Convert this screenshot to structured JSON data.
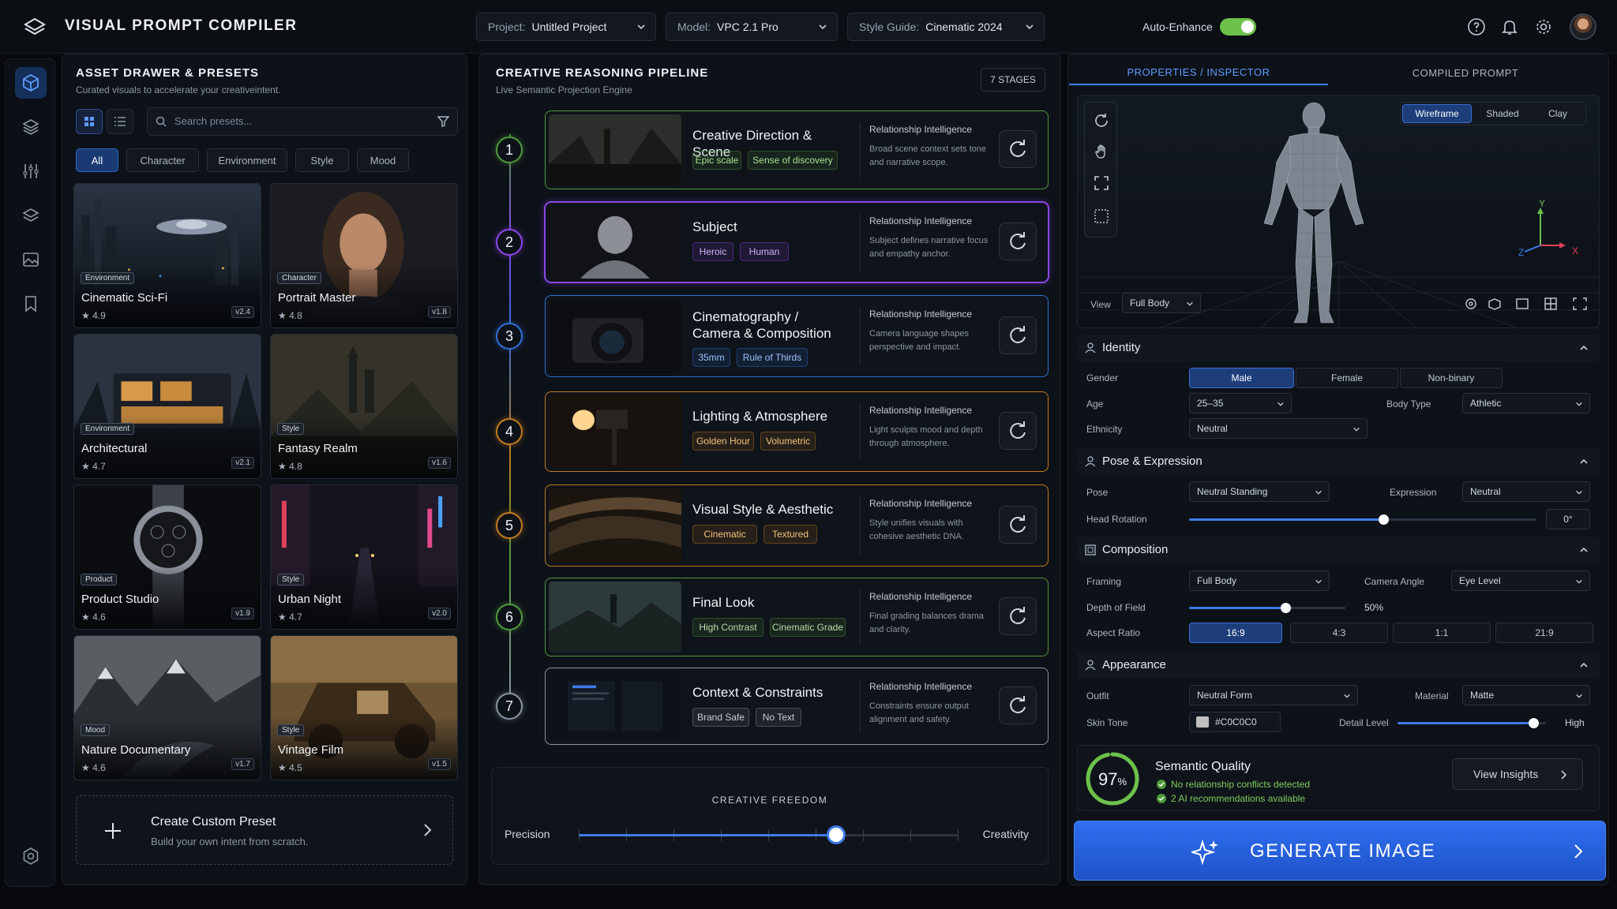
{
  "app": {
    "title": "VISUAL PROMPT COMPILER"
  },
  "topbar": {
    "project_key": "Project:",
    "project_value": "Untitled Project",
    "model_key": "Model:",
    "model_value": "VPC 2.1 Pro",
    "style_key": "Style Guide:",
    "style_value": "Cinematic 2024",
    "auto_enhance_label": "Auto-Enhance",
    "auto_enhance_on": true
  },
  "sidebar": {
    "items": [
      "cube-icon",
      "layers-icon",
      "sliders-icon",
      "stack-icon",
      "image-icon",
      "bookmark-icon"
    ],
    "active": 0
  },
  "assets": {
    "title": "ASSET DRAWER & PRESETS",
    "subtitle": "Curated visuals to accelerate your creativeintent.",
    "search_placeholder": "Search presets...",
    "filters": [
      "All",
      "Character",
      "Environment",
      "Style",
      "Mood"
    ],
    "active_filter": "All",
    "cards": [
      {
        "tag": "Environment",
        "name": "Cinematic Sci-Fi",
        "rating": "★ 4.9",
        "version": "v2.4"
      },
      {
        "tag": "Character",
        "name": "Portrait Master",
        "rating": "★ 4.8",
        "version": "v1.8"
      },
      {
        "tag": "Environment",
        "name": "Architectural",
        "rating": "★ 4.7",
        "version": "v2.1"
      },
      {
        "tag": "Style",
        "name": "Fantasy Realm",
        "rating": "★ 4.8",
        "version": "v1.6"
      },
      {
        "tag": "Product",
        "name": "Product Studio",
        "rating": "★ 4.6",
        "version": "v1.9"
      },
      {
        "tag": "Style",
        "name": "Urban Night",
        "rating": "★ 4.7",
        "version": "v2.0"
      },
      {
        "tag": "Mood",
        "name": "Nature Documentary",
        "rating": "★ 4.6",
        "version": "v1.7"
      },
      {
        "tag": "Style",
        "name": "Vintage Film",
        "rating": "★ 4.5",
        "version": "v1.5"
      }
    ],
    "custom_title": "Create Custom Preset",
    "custom_sub": "Build your own intent from scratch."
  },
  "pipeline": {
    "title": "CREATIVE REASONING PIPELINE",
    "subtitle": "Live Semantic Projection Engine",
    "badge": "7 STAGES",
    "stages": [
      {
        "n": "1",
        "title": "Creative Direction & Scene",
        "pills": [
          "Epic scale",
          "Sense of discovery"
        ],
        "ri": "Relationship Intelligence",
        "desc": "Broad scene context sets tone and narrative scope.",
        "color": "#4f9a3c"
      },
      {
        "n": "2",
        "title": "Subject",
        "pills": [
          "Heroic",
          "Human"
        ],
        "ri": "Relationship Intelligence",
        "desc": "Subject defines narrative focus and empathy anchor.",
        "color": "#8b46e8"
      },
      {
        "n": "3",
        "title": "Cinematography / Camera & Composition",
        "pills": [
          "35mm",
          "Rule of Thirds"
        ],
        "ri": "Relationship Intelligence",
        "desc": "Camera language shapes perspective and impact.",
        "color": "#2f6fd8"
      },
      {
        "n": "4",
        "title": "Lighting & Atmosphere",
        "pills": [
          "Golden Hour",
          "Volumetric"
        ],
        "ri": "Relationship Intelligence",
        "desc": "Light sculpts mood and depth through atmosphere.",
        "color": "#c27a1e"
      },
      {
        "n": "5",
        "title": "Visual Style & Aesthetic",
        "pills": [
          "Cinematic",
          "Textured"
        ],
        "ri": "Relationship Intelligence",
        "desc": "Style unifies visuals with cohesive aesthetic DNA.",
        "color": "#c27a1e"
      },
      {
        "n": "6",
        "title": "Final Look",
        "pills": [
          "High Contrast",
          "Cinematic Grade"
        ],
        "ri": "Relationship Intelligence",
        "desc": "Final grading balances drama and clarity.",
        "color": "#4f9a3c"
      },
      {
        "n": "7",
        "title": "Context & Constraints",
        "pills": [
          "Brand Safe",
          "No Text"
        ],
        "ri": "Relationship Intelligence",
        "desc": "Constraints ensure output alignment and safety.",
        "color": "#8a93a0"
      }
    ],
    "freedom_title": "CREATIVE FREEDOM",
    "freedom_left": "Precision",
    "freedom_right": "Creativity",
    "freedom_value": 0.68
  },
  "inspector": {
    "tabs": [
      "PROPERTIES / INSPECTOR",
      "COMPILED PROMPT"
    ],
    "active_tab": 0,
    "render_modes": [
      "Wireframe",
      "Shaded",
      "Clay"
    ],
    "active_mode": "Wireframe",
    "view_label": "View",
    "view_value": "Full Body",
    "axes": {
      "x": "X",
      "y": "Y",
      "z": "Z"
    },
    "identity": {
      "title": "Identity",
      "gender_label": "Gender",
      "gender_options": [
        "Male",
        "Female",
        "Non-binary"
      ],
      "gender_active": "Male",
      "age_label": "Age",
      "age_value": "25–35",
      "body_label": "Body Type",
      "body_value": "Athletic",
      "ethnicity_label": "Ethnicity",
      "ethnicity_value": "Neutral"
    },
    "pose": {
      "title": "Pose & Expression",
      "pose_label": "Pose",
      "pose_value": "Neutral Standing",
      "expr_label": "Expression",
      "expr_value": "Neutral",
      "head_label": "Head Rotation",
      "head_value": "0°",
      "head_slider": 0.56
    },
    "composition": {
      "title": "Composition",
      "framing_label": "Framing",
      "framing_value": "Full Body",
      "angle_label": "Camera Angle",
      "angle_value": "Eye Level",
      "dof_label": "Depth of Field",
      "dof_value": "50%",
      "dof_slider": 0.62,
      "aspect_label": "Aspect Ratio",
      "aspect_options": [
        "16:9",
        "4:3",
        "1:1",
        "21:9"
      ],
      "aspect_active": "16:9"
    },
    "appearance": {
      "title": "Appearance",
      "outfit_label": "Outfit",
      "outfit_value": "Neutral Form",
      "material_label": "Material",
      "material_value": "Matte",
      "skin_label": "Skin Tone",
      "skin_value": "#C0C0C0",
      "detail_label": "Detail Level",
      "detail_value": "High",
      "detail_slider": 0.92
    },
    "quality": {
      "score": "97",
      "score_unit": "%",
      "fraction": 0.97,
      "title": "Semantic Quality",
      "line1": "No relationship conflicts detected",
      "line2": "2 AI recommendations available",
      "insights_label": "View Insights"
    },
    "generate_label": "GENERATE IMAGE"
  }
}
